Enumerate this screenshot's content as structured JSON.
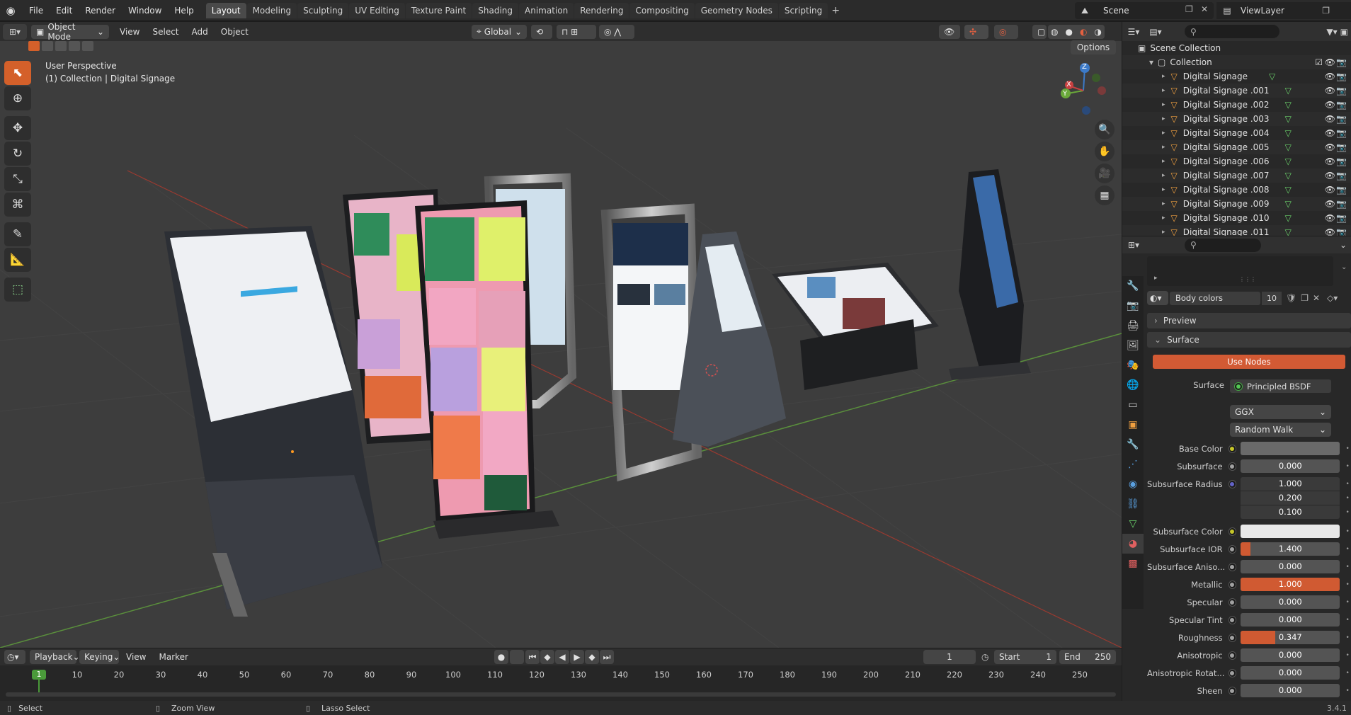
{
  "topbar": {
    "menus": [
      "File",
      "Edit",
      "Render",
      "Window",
      "Help"
    ],
    "tabs": [
      "Layout",
      "Modeling",
      "Sculpting",
      "UV Editing",
      "Texture Paint",
      "Shading",
      "Animation",
      "Rendering",
      "Compositing",
      "Geometry Nodes",
      "Scripting"
    ],
    "active_tab": "Layout",
    "scene_name": "Scene",
    "view_layer": "ViewLayer"
  },
  "viewport": {
    "mode": "Object Mode",
    "menus": [
      "View",
      "Select",
      "Add",
      "Object"
    ],
    "transform_orientation": "Global",
    "options_label": "Options",
    "overlay_line1": "User Perspective",
    "overlay_line2": "(1) Collection | Digital Signage",
    "gizmo_axes": {
      "x": "X",
      "y": "Y",
      "z": "Z"
    }
  },
  "outliner": {
    "search_placeholder": "",
    "scene_collection": "Scene Collection",
    "collection": "Collection",
    "items": [
      "Digital Signage",
      "Digital Signage .001",
      "Digital Signage .002",
      "Digital Signage .003",
      "Digital Signage .004",
      "Digital Signage .005",
      "Digital Signage .006",
      "Digital Signage .007",
      "Digital Signage .008",
      "Digital Signage .009",
      "Digital Signage .010",
      "Digital Signage .011"
    ]
  },
  "properties": {
    "material_name": "Body colors",
    "material_users": "10",
    "preview_label": "Preview",
    "surface_panel_label": "Surface",
    "use_nodes_label": "Use Nodes",
    "surface_label": "Surface",
    "surface_shader": "Principled BSDF",
    "distribution": "GGX",
    "subsurface_method": "Random Walk",
    "rows": [
      {
        "label": "Base Color",
        "value": "",
        "socket": "#c7c729",
        "kind": "color",
        "color": "#6a6a6a"
      },
      {
        "label": "Subsurface",
        "value": "0.000",
        "socket": "#a1a1a1",
        "kind": "num",
        "fill": 0
      },
      {
        "label": "Subsurface Radius",
        "value": "1.000",
        "socket": "#6363c7",
        "kind": "vec"
      },
      {
        "label": "",
        "value": "0.200",
        "kind": "vec2"
      },
      {
        "label": "",
        "value": "0.100",
        "kind": "vec3"
      },
      {
        "label": "Subsurface Color",
        "value": "",
        "socket": "#c7c729",
        "kind": "color",
        "color": "#e8e8e8"
      },
      {
        "label": "Subsurface IOR",
        "value": "1.400",
        "socket": "#a1a1a1",
        "kind": "num",
        "fill": 0.1
      },
      {
        "label": "Subsurface Aniso...",
        "value": "0.000",
        "socket": "#a1a1a1",
        "kind": "num",
        "fill": 0
      },
      {
        "label": "Metallic",
        "value": "1.000",
        "socket": "#a1a1a1",
        "kind": "num",
        "fill": 1
      },
      {
        "label": "Specular",
        "value": "0.000",
        "socket": "#a1a1a1",
        "kind": "num",
        "fill": 0
      },
      {
        "label": "Specular Tint",
        "value": "0.000",
        "socket": "#a1a1a1",
        "kind": "num",
        "fill": 0
      },
      {
        "label": "Roughness",
        "value": "0.347",
        "socket": "#a1a1a1",
        "kind": "num",
        "fill": 0.347
      },
      {
        "label": "Anisotropic",
        "value": "0.000",
        "socket": "#a1a1a1",
        "kind": "num",
        "fill": 0
      },
      {
        "label": "Anisotropic Rotat...",
        "value": "0.000",
        "socket": "#a1a1a1",
        "kind": "num",
        "fill": 0
      },
      {
        "label": "Sheen",
        "value": "0.000",
        "socket": "#a1a1a1",
        "kind": "num",
        "fill": 0
      }
    ]
  },
  "timeline": {
    "playback": "Playback",
    "keying": "Keying",
    "view": "View",
    "marker": "Marker",
    "current_frame": "1",
    "start_label": "Start",
    "start": "1",
    "end_label": "End",
    "end": "250",
    "ticks": [
      "10",
      "20",
      "30",
      "40",
      "50",
      "60",
      "70",
      "80",
      "90",
      "100",
      "110",
      "120",
      "130",
      "140",
      "150",
      "160",
      "170",
      "180",
      "190",
      "200",
      "210",
      "220",
      "230",
      "240",
      "250"
    ],
    "playhead": "1"
  },
  "statusbar": {
    "select": "Select",
    "zoom_view": "Zoom View",
    "lasso_select": "Lasso Select",
    "version": "3.4.1"
  },
  "colors": {
    "accent": "#d4602a",
    "selected_row": "#334d80"
  }
}
